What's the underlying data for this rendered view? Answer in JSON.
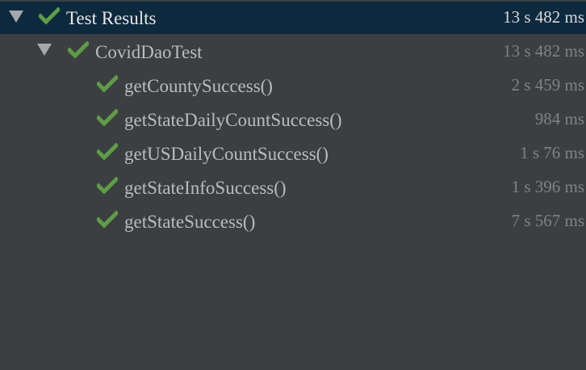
{
  "colors": {
    "background": "#3c3f41",
    "selection": "#0d293e",
    "pass_green": "#5d9e44",
    "duration_gray": "#7f8285"
  },
  "tree": {
    "root": {
      "label": "Test Results",
      "duration": "13 s  482 ms",
      "status": "passed",
      "expanded": true,
      "selected": true,
      "icon": "check-icon"
    },
    "suite": {
      "label": "CovidDaoTest",
      "duration": "13 s  482 ms",
      "status": "passed",
      "expanded": true,
      "icon": "check-icon"
    },
    "tests": [
      {
        "label": "getCountySuccess()",
        "duration": "2 s  459 ms",
        "status": "passed",
        "icon": "check-icon"
      },
      {
        "label": "getStateDailyCountSuccess()",
        "duration": "984 ms",
        "status": "passed",
        "icon": "check-icon"
      },
      {
        "label": "getUSDailyCountSuccess()",
        "duration": "1 s  76 ms",
        "status": "passed",
        "icon": "check-icon"
      },
      {
        "label": "getStateInfoSuccess()",
        "duration": "1 s  396 ms",
        "status": "passed",
        "icon": "check-icon"
      },
      {
        "label": "getStateSuccess()",
        "duration": "7 s  567 ms",
        "status": "passed",
        "icon": "check-icon"
      }
    ]
  }
}
